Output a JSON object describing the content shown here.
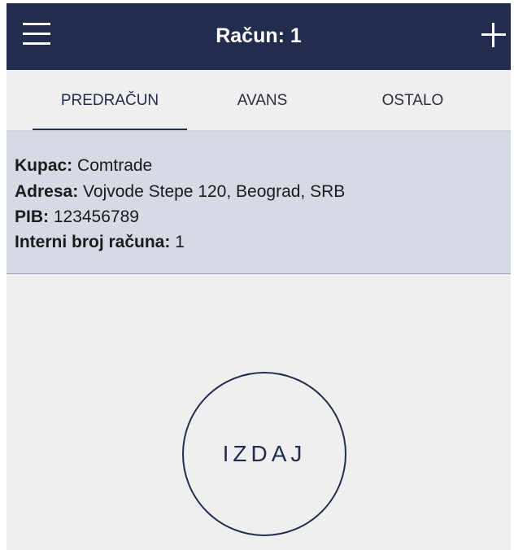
{
  "header": {
    "title": "Račun: 1",
    "menu_icon": "hamburger-menu-icon",
    "add_icon": "plus-icon"
  },
  "tabs": [
    {
      "label": "PREDRAČUN",
      "active": true
    },
    {
      "label": "AVANS",
      "active": false
    },
    {
      "label": "OSTALO",
      "active": false
    }
  ],
  "info": {
    "kupac_label": "Kupac:",
    "kupac_value": "Comtrade",
    "adresa_label": "Adresa:",
    "adresa_value": "Vojvode Stepe 120, Beograd, SRB",
    "pib_label": "PIB:",
    "pib_value": "123456789",
    "interni_label": "Interni broj računa:",
    "interni_value": "1"
  },
  "action": {
    "issue_label": "IZDAJ"
  },
  "colors": {
    "primary": "#222c4c",
    "info_background": "#d6dae5",
    "page_background": "#efefef"
  }
}
